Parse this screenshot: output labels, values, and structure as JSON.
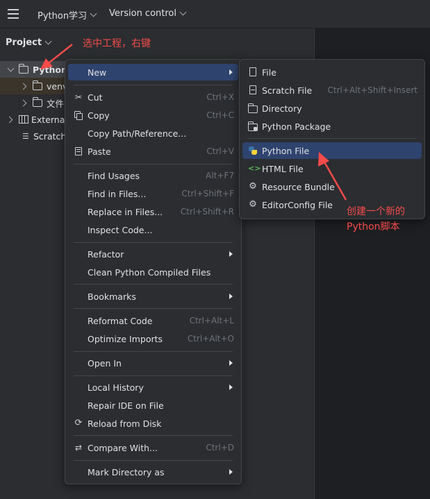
{
  "topbar": {
    "project": "Python学习",
    "vcs": "Version control"
  },
  "project_panel": {
    "title": "Project"
  },
  "tree": [
    {
      "label": "Python"
    },
    {
      "label": "venv"
    },
    {
      "label": "文件"
    },
    {
      "label": "External"
    },
    {
      "label": "Scratche"
    }
  ],
  "context_menu": {
    "items": [
      {
        "label": "New",
        "shortcut": ""
      },
      {
        "label": "Cut",
        "shortcut": "Ctrl+X"
      },
      {
        "label": "Copy",
        "shortcut": "Ctrl+C"
      },
      {
        "label": "Copy Path/Reference...",
        "shortcut": ""
      },
      {
        "label": "Paste",
        "shortcut": "Ctrl+V"
      },
      {
        "label": "Find Usages",
        "shortcut": "Alt+F7"
      },
      {
        "label": "Find in Files...",
        "shortcut": "Ctrl+Shift+F"
      },
      {
        "label": "Replace in Files...",
        "shortcut": "Ctrl+Shift+R"
      },
      {
        "label": "Inspect Code...",
        "shortcut": ""
      },
      {
        "label": "Refactor",
        "shortcut": ""
      },
      {
        "label": "Clean Python Compiled Files",
        "shortcut": ""
      },
      {
        "label": "Bookmarks",
        "shortcut": ""
      },
      {
        "label": "Reformat Code",
        "shortcut": "Ctrl+Alt+L"
      },
      {
        "label": "Optimize Imports",
        "shortcut": "Ctrl+Alt+O"
      },
      {
        "label": "Open In",
        "shortcut": ""
      },
      {
        "label": "Local History",
        "shortcut": ""
      },
      {
        "label": "Repair IDE on File",
        "shortcut": ""
      },
      {
        "label": "Reload from Disk",
        "shortcut": ""
      },
      {
        "label": "Compare With...",
        "shortcut": "Ctrl+D"
      },
      {
        "label": "Mark Directory as",
        "shortcut": ""
      }
    ]
  },
  "new_submenu": {
    "items": [
      {
        "label": "File",
        "shortcut": ""
      },
      {
        "label": "Scratch File",
        "shortcut": "Ctrl+Alt+Shift+Insert"
      },
      {
        "label": "Directory",
        "shortcut": ""
      },
      {
        "label": "Python Package",
        "shortcut": ""
      },
      {
        "label": "Python File",
        "shortcut": ""
      },
      {
        "label": "HTML File",
        "shortcut": ""
      },
      {
        "label": "Resource Bundle",
        "shortcut": ""
      },
      {
        "label": "EditorConfig File",
        "shortcut": ""
      }
    ]
  },
  "annotations": {
    "select_project": "选中工程，右键",
    "create_line1": "创建一个新的",
    "create_line2": "Python脚本"
  },
  "colors": {
    "annotation": "#f44b4b",
    "selection": "#2e436e",
    "python_blue": "#3b77a8",
    "python_yellow": "#ffd43b"
  }
}
